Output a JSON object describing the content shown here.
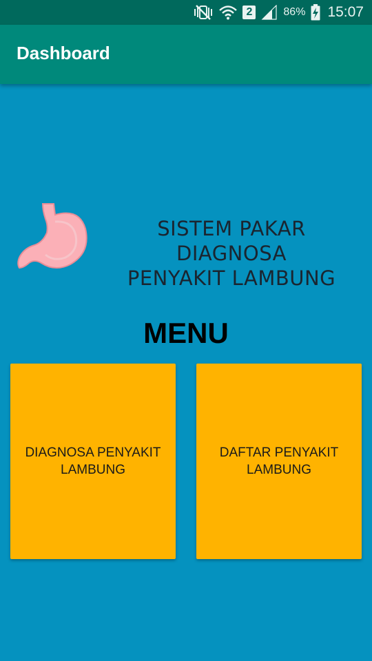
{
  "status_bar": {
    "battery": "86%",
    "sim_slot": "2",
    "time": "15:07",
    "icons": [
      "mute-vibrate-icon",
      "wifi-icon",
      "sim-2-icon",
      "signal-icon",
      "battery-charging-icon"
    ]
  },
  "app_bar": {
    "title": "Dashboard",
    "color": "#00897b"
  },
  "logo": {
    "line1": "SISTEM PAKAR DIAGNOSA",
    "line2": "PENYAKIT LAMBUNG",
    "icon": "stomach-icon"
  },
  "menu": {
    "title": "MENU",
    "items": [
      {
        "label": "DIAGNOSA PENYAKIT LAMBUNG"
      },
      {
        "label": "DAFTAR PENYAKIT LAMBUNG"
      }
    ],
    "card_color": "#ffb300"
  },
  "colors": {
    "background": "#0592bf",
    "status_bar": "#00695c"
  }
}
